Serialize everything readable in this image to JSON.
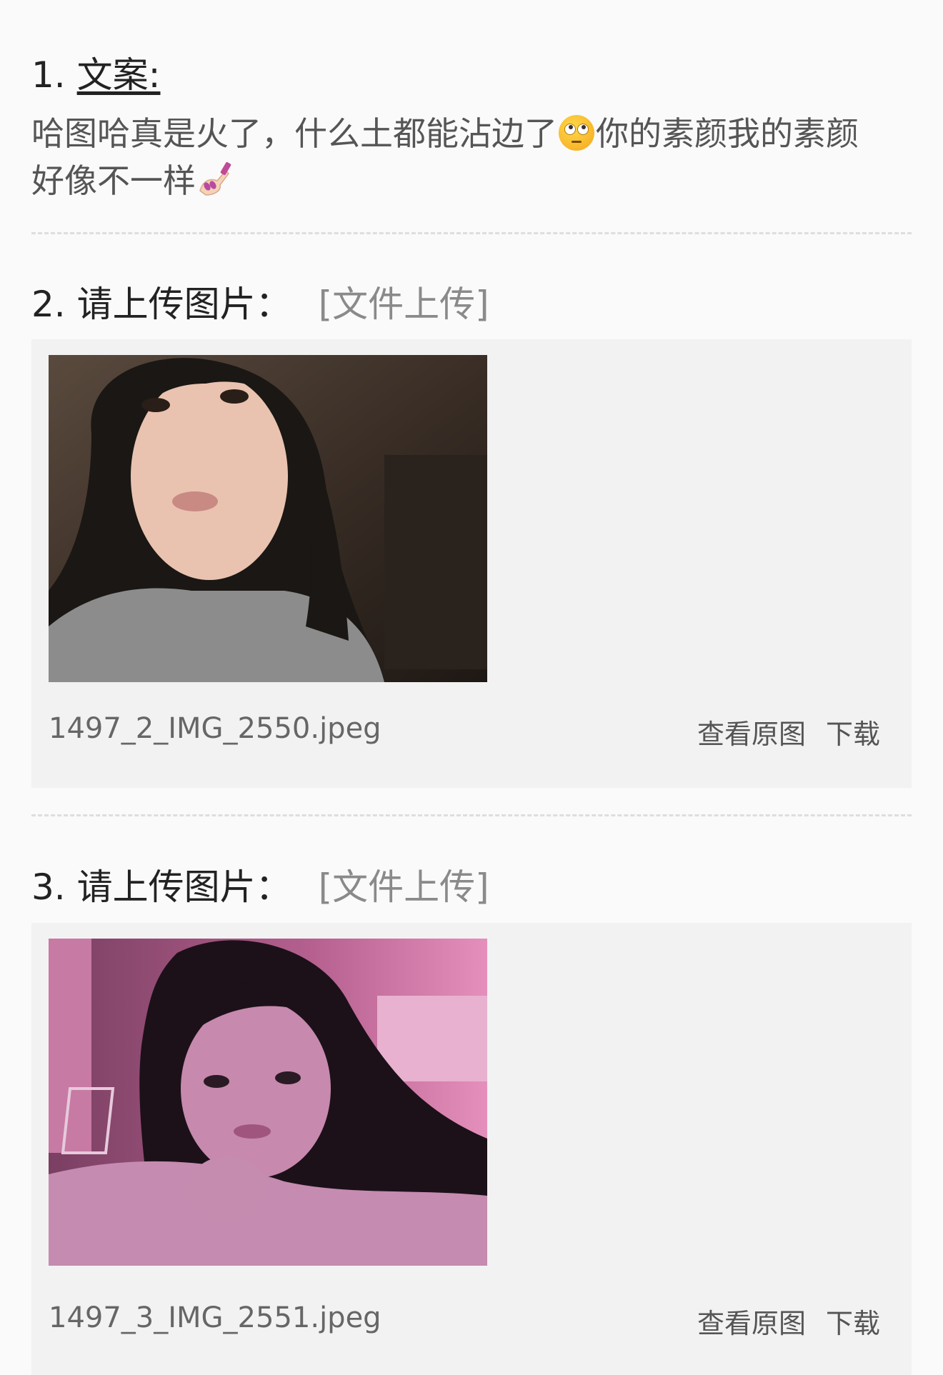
{
  "q1": {
    "number": "1.",
    "title": "文案:",
    "text_a": "哈图哈真是火了，什么土",
    "text_b": "都能沾边了",
    "text_c": "你的素颜我的素颜",
    "text_d": "好像不一样"
  },
  "q2": {
    "number": "2.",
    "title": "请上传图片：",
    "tag": "[文件上传]",
    "file_name": "1497_2_IMG_2550.jpeg",
    "view_label": "查看原图",
    "download_label": "下载"
  },
  "q3": {
    "number": "3.",
    "title": "请上传图片：",
    "tag": "[文件上传]",
    "file_name": "1497_3_IMG_2551.jpeg",
    "view_label": "查看原图",
    "download_label": "下载"
  },
  "icons": {
    "emoji_1": "eye-roll-emoji-icon",
    "emoji_2": "nail-polish-emoji-icon"
  }
}
